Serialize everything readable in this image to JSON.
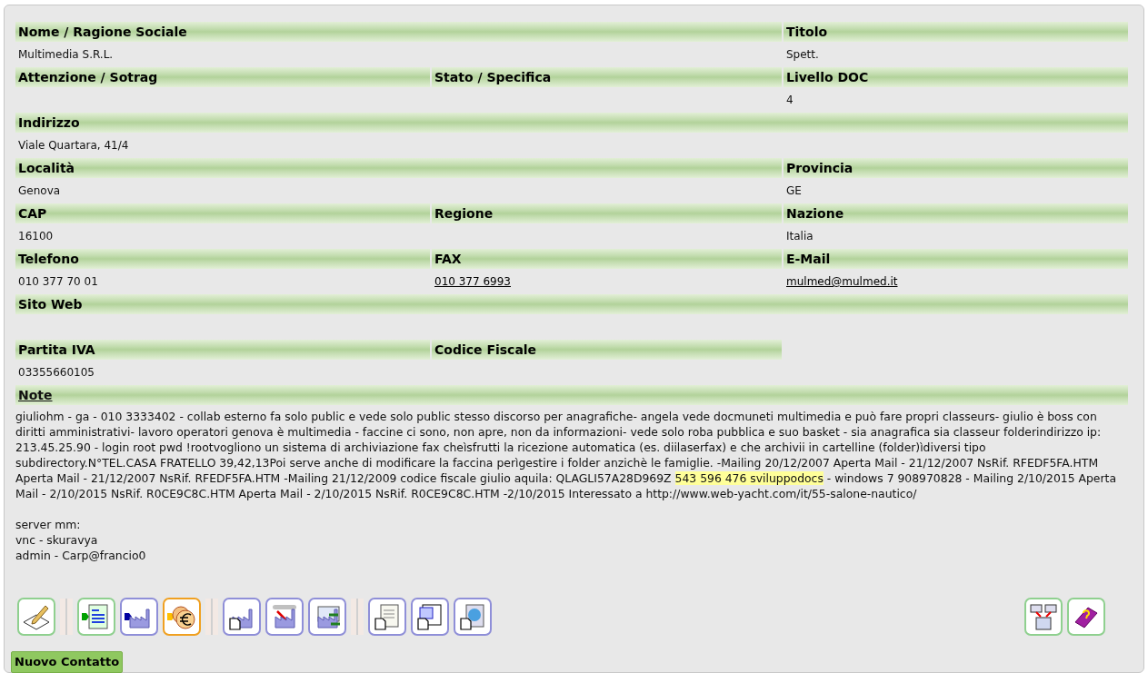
{
  "rows": [
    {
      "cells": [
        {
          "header": "Nome / Ragione Sociale",
          "value": "Multimedia S.R.L.",
          "wide": true
        },
        {
          "header": "Titolo",
          "value": "Spett."
        }
      ]
    },
    {
      "cells": [
        {
          "header": "Attenzione / Sotrag"
        },
        {
          "header": "Stato / Specifica"
        },
        {
          "header": "Livello DOC",
          "value": "4"
        }
      ]
    },
    {
      "cells": [
        {
          "header": "Indirizzo",
          "value": "Viale Quartara, 41/4",
          "full": true
        }
      ]
    },
    {
      "cells": [
        {
          "header": "Località",
          "value": "Genova",
          "wide": true
        },
        {
          "header": "Provincia",
          "value": "GE"
        }
      ]
    },
    {
      "cells": [
        {
          "header": "CAP",
          "value": "16100"
        },
        {
          "header": "Regione"
        },
        {
          "header": "Nazione",
          "value": "Italia"
        }
      ]
    },
    {
      "cells": [
        {
          "header": "Telefono",
          "value": "010 377 70 01"
        },
        {
          "header": "FAX",
          "value": "010 377 6993",
          "link": true
        },
        {
          "header": "E-Mail",
          "value": "mulmed@mulmed.it",
          "link": true
        }
      ]
    },
    {
      "cells": [
        {
          "header": "Sito Web",
          "full": true
        }
      ]
    },
    {
      "cells": [
        {
          "header": "Partita IVA",
          "value": "03355660105"
        },
        {
          "header": "Codice Fiscale"
        }
      ]
    }
  ],
  "note": {
    "header": "Note",
    "text_before": "giuliohm - ga - 010 3333402 - collab esterno fa solo public e vede solo public stesso discorso per anagrafiche- angela vede docmuneti multimedia e può fare propri classeurs- giulio è boss con diritti amministrativi- lavoro operatori genova è multimedia - faccine ci sono, non apre, non da informazioni- vede solo roba pubblica e suo basket - sia anagrafica sia classeur folderindirizzo ip: 213.45.25.90 - login root pwd !rootvogliono un sistema di archiviazione fax cheìsfrutti la ricezione automatica (es. diilaserfax) e che archivii in cartelline (folder)ìdiversi tipo subdirectory.N°TEL.CASA FRATELLO 39,42,13Poi serve anche di modificare la faccina perìgestire i folder anzichè le famiglie. -Mailing 20/12/2007 Aperta Mail - 21/12/2007 NsRif. RFEDF5FA.HTM Aperta Mail - 21/12/2007 NsRif. RFEDF5FA.HTM -Mailing 21/12/2009 codice fiscale giulio aquila: QLAGLI57A28D969Z ",
    "highlight": "543 596 476 sviluppodocs",
    "text_after": " - windows 7 908970828 - Mailing 2/10/2015 Aperta Mail - 2/10/2015 NsRif. R0CE9C8C.HTM Aperta Mail - 2/10/2015 NsRif. R0CE9C8C.HTM -2/10/2015 Interessato a http://www.web-yacht.com/it/55-salone-nautico/",
    "extra_lines": [
      "server mm:",
      "vnc - skuravya",
      "admin - Carp@francio0"
    ]
  },
  "new_contact_button": "Nuovo Contatto"
}
